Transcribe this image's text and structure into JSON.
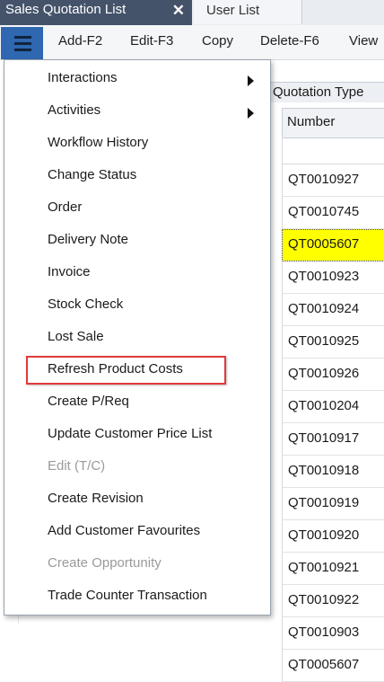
{
  "tabs": [
    {
      "label": "Sales Quotation List",
      "active": true
    },
    {
      "label": "User List",
      "active": false
    }
  ],
  "close_glyph": "✕",
  "toolbar": {
    "menu_icon": "hamburger-menu-icon",
    "buttons": [
      "Add-F2",
      "Edit-F3",
      "Copy",
      "Delete-F6",
      "View"
    ]
  },
  "grid": {
    "group_header": "Quotation Type",
    "column_header": "Number",
    "rows": [
      {
        "number": "QT0010927",
        "highlighted": false
      },
      {
        "number": "QT0010745",
        "highlighted": false
      },
      {
        "number": "QT0005607",
        "highlighted": true
      },
      {
        "number": "QT0010923",
        "highlighted": false
      },
      {
        "number": "QT0010924",
        "highlighted": false
      },
      {
        "number": "QT0010925",
        "highlighted": false
      },
      {
        "number": "QT0010926",
        "highlighted": false
      },
      {
        "number": "QT0010204",
        "highlighted": false
      },
      {
        "number": "QT0010917",
        "highlighted": false
      },
      {
        "number": "QT0010918",
        "highlighted": false
      },
      {
        "number": "QT0010919",
        "highlighted": false
      },
      {
        "number": "QT0010920",
        "highlighted": false
      },
      {
        "number": "QT0010921",
        "highlighted": false
      },
      {
        "number": "QT0010922",
        "highlighted": false
      },
      {
        "number": "QT0010903",
        "highlighted": false
      },
      {
        "number": "QT0005607",
        "highlighted": false
      }
    ]
  },
  "menu": {
    "items": [
      {
        "label": "Interactions",
        "submenu": true,
        "disabled": false
      },
      {
        "label": "Activities",
        "submenu": true,
        "disabled": false
      },
      {
        "label": "Workflow History",
        "submenu": false,
        "disabled": false
      },
      {
        "label": "Change Status",
        "submenu": false,
        "disabled": false
      },
      {
        "label": "Order",
        "submenu": false,
        "disabled": false
      },
      {
        "label": "Delivery Note",
        "submenu": false,
        "disabled": false
      },
      {
        "label": "Invoice",
        "submenu": false,
        "disabled": false
      },
      {
        "label": "Stock Check",
        "submenu": false,
        "disabled": false
      },
      {
        "label": "Lost Sale",
        "submenu": false,
        "disabled": false
      },
      {
        "label": "Refresh Product Costs",
        "submenu": false,
        "disabled": false,
        "annotated": true
      },
      {
        "label": "Create P/Req",
        "submenu": false,
        "disabled": false
      },
      {
        "label": "Update Customer Price List",
        "submenu": false,
        "disabled": false
      },
      {
        "label": "Edit (T/C)",
        "submenu": false,
        "disabled": true
      },
      {
        "label": "Create Revision",
        "submenu": false,
        "disabled": false
      },
      {
        "label": "Add Customer Favourites",
        "submenu": false,
        "disabled": false
      },
      {
        "label": "Create Opportunity",
        "submenu": false,
        "disabled": true
      },
      {
        "label": "Trade Counter Transaction",
        "submenu": false,
        "disabled": false
      }
    ]
  },
  "colors": {
    "active_tab": "#44536a",
    "menu_button": "#2f67b0",
    "row_highlight": "#ffff00",
    "annotation_box": "#e03a3a"
  }
}
